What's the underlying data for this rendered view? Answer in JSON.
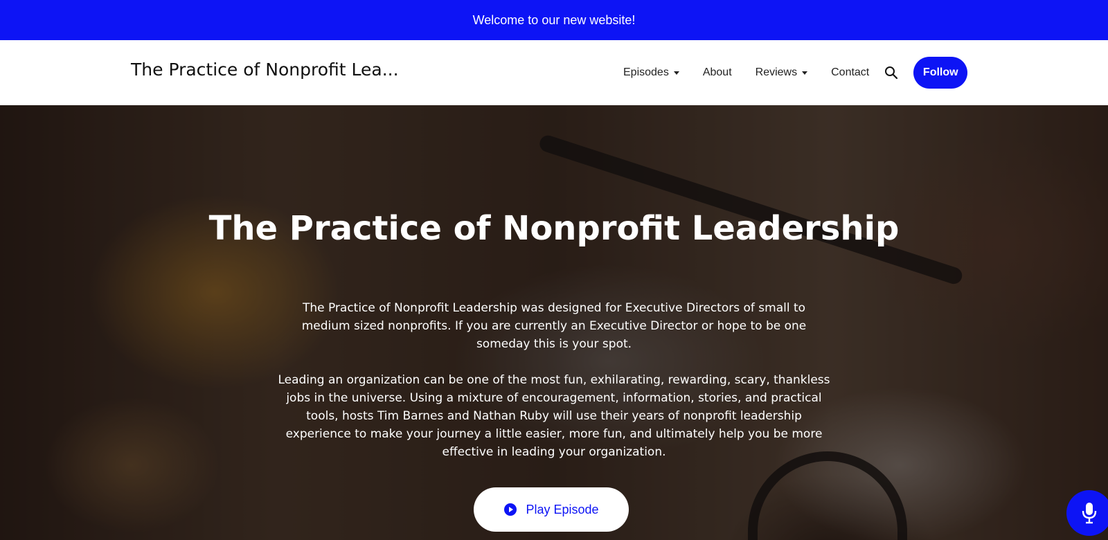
{
  "announcement": "Welcome to our new website!",
  "header": {
    "site_title": "The Practice of Nonprofit Lea...",
    "nav": {
      "episodes": "Episodes",
      "about": "About",
      "reviews": "Reviews",
      "contact": "Contact"
    },
    "follow_label": "Follow"
  },
  "hero": {
    "title": "The Practice of Nonprofit Leadership",
    "paragraph1": "The Practice of Nonprofit Leadership was designed for Executive Directors of small to medium sized nonprofits.  If you are currently an Executive Director or hope to be one someday this is your spot.",
    "paragraph2": "Leading an organization can be one of the most fun, exhilarating, rewarding, scary, thankless jobs in the universe.  Using a mixture of encouragement, information, stories, and practical tools, hosts Tim Barnes and Nathan Ruby will use their years of nonprofit leadership experience to make your journey a little easier,  more fun, and ultimately help you be more effective in leading your organization.",
    "play_label": "Play Episode"
  },
  "icons": {
    "search": "search-icon",
    "play": "play-circle-icon",
    "microphone": "microphone-icon",
    "caret": "caret-down-icon"
  },
  "colors": {
    "brand_blue": "#0d14f5",
    "header_bg": "#ffffff",
    "text_dark": "#111111"
  }
}
